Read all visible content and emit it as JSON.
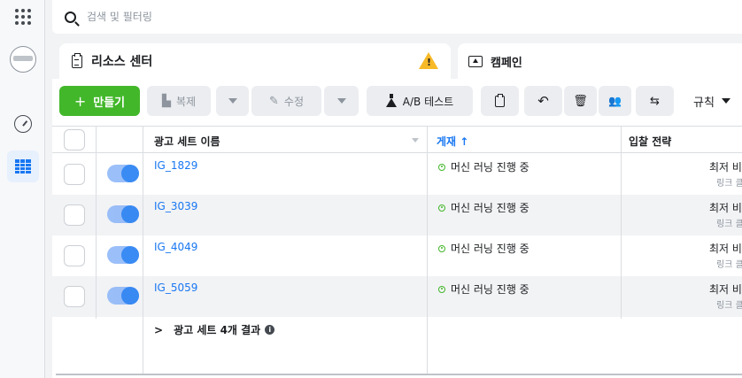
{
  "search": {
    "placeholder": "검색 및 필터링"
  },
  "tabs": [
    {
      "label": "리소스 센터",
      "warning": "!"
    },
    {
      "label": "캠페인"
    }
  ],
  "toolbar": {
    "create": "만들기",
    "create_plus": "+",
    "duplicate": "복제",
    "edit": "수정",
    "ab_test": "A/B 테스트",
    "rules": "규칙",
    "icons": [
      "duplicate-icon",
      "edit-icon",
      "flask-icon",
      "clipboard-icon",
      "undo-icon",
      "trash-icon",
      "people-icon",
      "preview-icon"
    ]
  },
  "table": {
    "headers": {
      "name": "광고 세트 이름",
      "delivery": "게재",
      "delivery_sort": "↑",
      "bid": "입찰 전략"
    },
    "rows": [
      {
        "name": "IG_1829",
        "delivery": "머신 러닝 진행 중",
        "bid": "최저 비용",
        "bid_sub": "링크 클릭",
        "on": true
      },
      {
        "name": "IG_3039",
        "delivery": "머신 러닝 진행 중",
        "bid": "최저 비용",
        "bid_sub": "링크 클릭",
        "on": true
      },
      {
        "name": "IG_4049",
        "delivery": "머신 러닝 진행 중",
        "bid": "최저 비용",
        "bid_sub": "링크 클릭",
        "on": true
      },
      {
        "name": "IG_5059",
        "delivery": "머신 러닝 진행 중",
        "bid": "최저 비용",
        "bid_sub": "링크 클릭",
        "on": true
      }
    ],
    "summary_chevron": ">",
    "summary": "광고 세트 4개 결과",
    "summary_info": "i"
  },
  "colors": {
    "accent": "#1877f2",
    "create": "#42b72a",
    "warning": "#f7b928",
    "status": "#42b72a"
  }
}
